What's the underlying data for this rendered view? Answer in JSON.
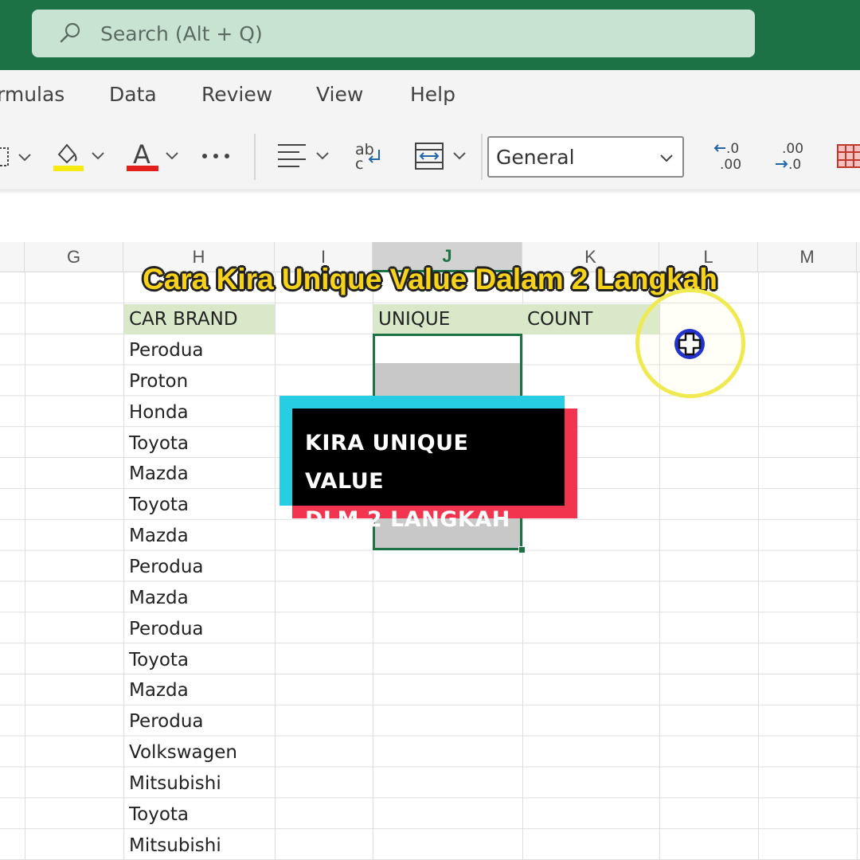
{
  "search": {
    "placeholder": "Search (Alt + Q)"
  },
  "menu": [
    "rmulas",
    "Data",
    "Review",
    "View",
    "Help"
  ],
  "ribbon": {
    "number_format": "General",
    "increase_decimal": "←.0\n.00",
    "decrease_decimal": ".00\n→.0"
  },
  "columns": [
    "G",
    "H",
    "I",
    "J",
    "K",
    "L",
    "M"
  ],
  "sheet": {
    "h_header": "CAR BRAND",
    "j_header": "UNIQUE",
    "k_header": "COUNT",
    "brands": [
      "Perodua",
      "Proton",
      "Honda",
      "Toyota",
      "Mazda",
      "Toyota",
      "Mazda",
      "Perodua",
      "Mazda",
      "Perodua",
      "Toyota",
      "Mazda",
      "Perodua",
      "Volkswagen",
      "Mitsubishi",
      "Toyota",
      "Mitsubishi"
    ]
  },
  "overlay": {
    "title": "Cara Kira Unique Value Dalam 2 Langkah",
    "tag_line1": "KIRA UNIQUE VALUE",
    "tag_line2": "DLM 2 LANGKAH"
  },
  "colors": {
    "excel_green": "#1d7245",
    "header_green": "#d8e8c8",
    "title_yellow": "#f7d21a",
    "tag_cyan": "#27cde3",
    "tag_red": "#f2344e"
  }
}
